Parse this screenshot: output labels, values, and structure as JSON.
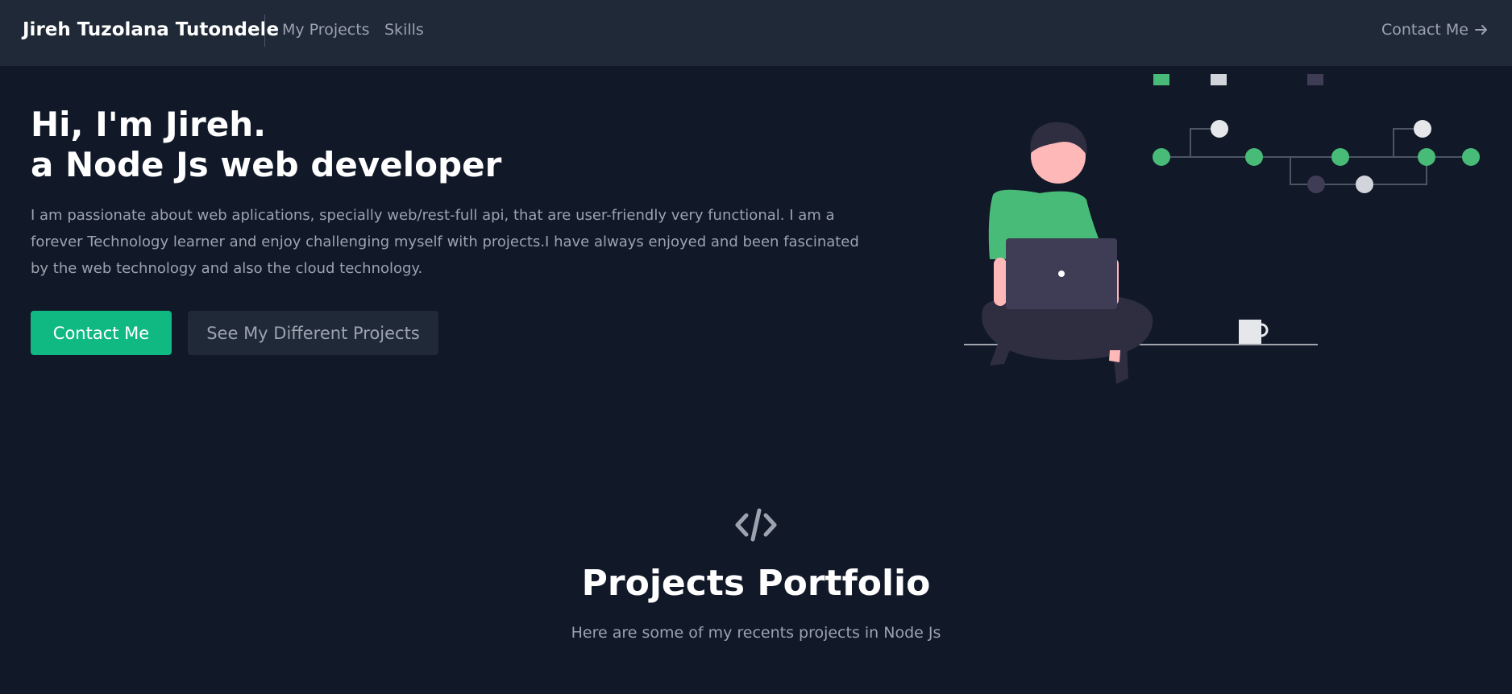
{
  "navbar": {
    "brand": "Jireh Tuzolana Tutondele",
    "links": [
      {
        "label": "My Projects"
      },
      {
        "label": "Skills"
      }
    ],
    "contact_label": "Contact Me",
    "contact_icon": "arrow-right-icon"
  },
  "hero": {
    "heading_line1": "Hi, I'm Jireh.",
    "heading_line2": "a Node Js web developer",
    "description": "I am passionate about web aplications, specially web/rest-full api, that are user-friendly very functional. I am a forever Technology learner and enjoy challenging myself with projects.I have always enjoyed and been fascinated by the web technology and also the cloud technology.",
    "primary_button": "Contact Me",
    "secondary_button": "See My Different Projects",
    "illustration": "developer-with-laptop-illustration"
  },
  "projects_section": {
    "icon": "code-icon",
    "title": "Projects Portfolio",
    "subtitle": "Here are some of my recents projects in Node Js"
  },
  "colors": {
    "background": "#111827",
    "navbar": "#1f2937",
    "accent": "#10b981",
    "muted_text": "#9ca3af"
  }
}
